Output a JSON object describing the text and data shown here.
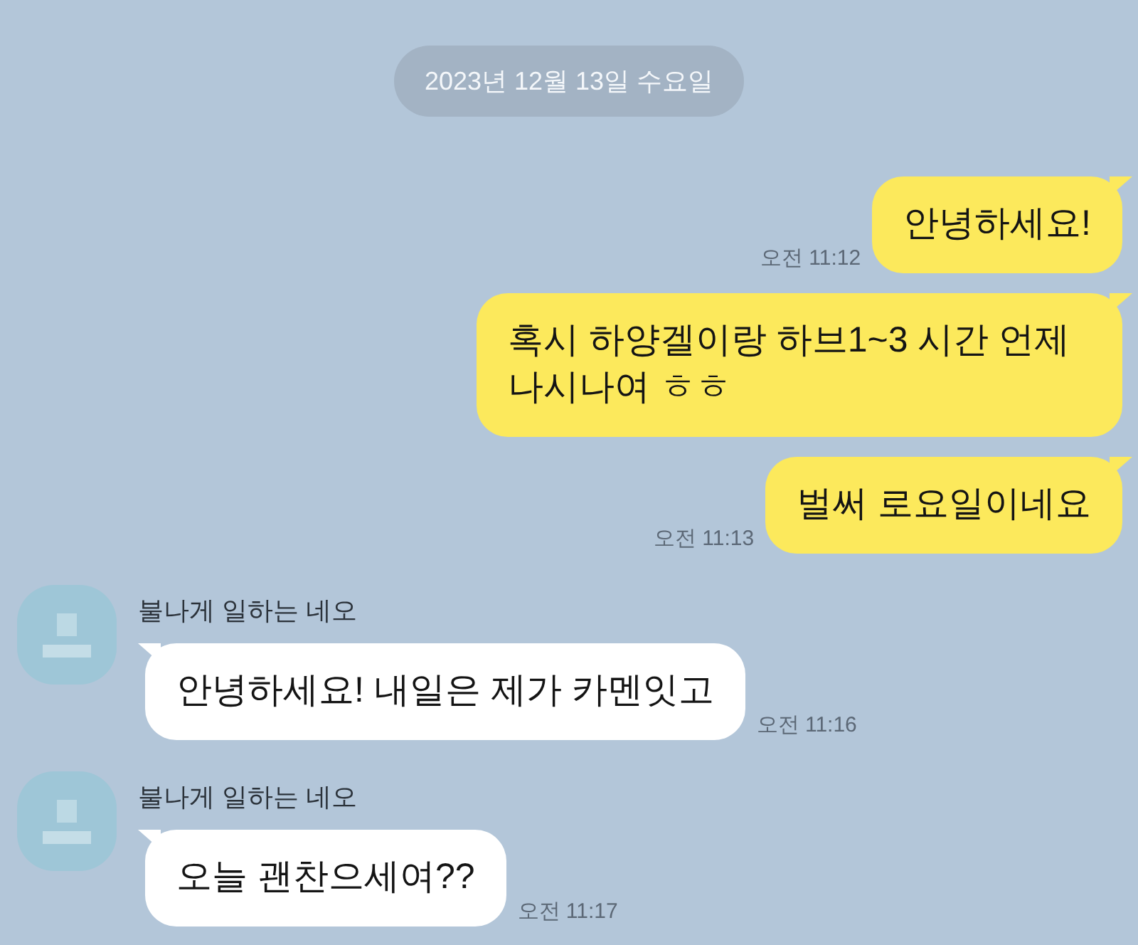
{
  "date_divider": "2023년 12월 13일 수요일",
  "messages": [
    {
      "kind": "sent",
      "text": "안녕하세요!",
      "time": "오전 11:12"
    },
    {
      "kind": "sent",
      "text": "혹시 하양겔이랑 하브1~3 시간 언제 나시나여 ㅎㅎ"
    },
    {
      "kind": "sent",
      "text": "벌써 로요일이네요",
      "time": "오전 11:13"
    },
    {
      "kind": "received",
      "sender": "불나게 일하는 네오",
      "text": "안녕하세요! 내일은 제가 카멘잇고",
      "time": "오전 11:16"
    },
    {
      "kind": "received",
      "sender": "불나게 일하는 네오",
      "text": "오늘 괜찬으세여??",
      "time": "오전 11:17"
    }
  ]
}
